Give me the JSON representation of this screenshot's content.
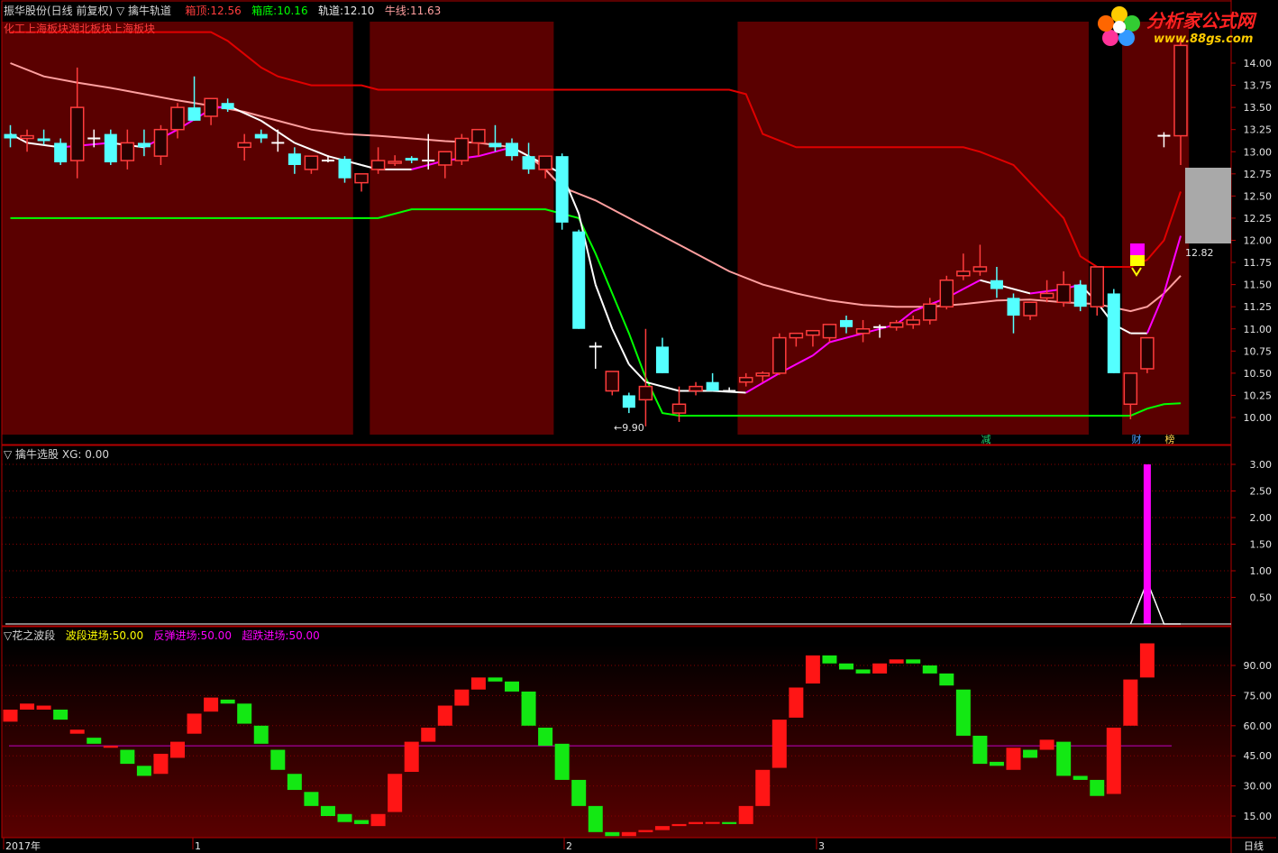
{
  "header": {
    "title": "振华股份(日线 前复权) ▽ 擒牛轨道",
    "box_top_label": "箱顶:",
    "box_top_value": "12.56",
    "box_bottom_label": "箱底:",
    "box_bottom_value": "10.16",
    "track_label": "轨道:",
    "track_value": "12.10",
    "bull_label": "牛线:",
    "bull_value": "11.63",
    "sectors": "化工上海板块湖北板块上海板块"
  },
  "logo": {
    "name": "分析家公式网",
    "url": "www.88gs.com"
  },
  "markers": {
    "min_label": "←9.90",
    "price_box": "12.82",
    "m1": "减",
    "m2": "财",
    "m3": "榜"
  },
  "panel2": {
    "title": "▽ 擒牛选股",
    "xg_label": "XG:",
    "xg_value": "0.00"
  },
  "panel3": {
    "title": "▽花之波段",
    "l1": "波段进场:",
    "v1": "50.00",
    "l2": "反弹进场:",
    "v2": "50.00",
    "l3": "超跌进场:",
    "v3": "50.00"
  },
  "footer": {
    "year": "2017年",
    "m1": "1",
    "m2": "2",
    "m3": "3",
    "period": "日线"
  },
  "colors": {
    "up": "#ff3c3c",
    "down": "#54ffff",
    "panel_bg": "#5a0000",
    "border": "#b40000",
    "green": "#00ff00",
    "magenta": "#ff00ff",
    "pink": "#ff9f9f"
  },
  "chart_data": [
    {
      "type": "candlestick",
      "title": "振华股份(日线 前复权)",
      "ylim": [
        9.8,
        14.2
      ],
      "yticks": [
        10.0,
        10.25,
        10.5,
        10.75,
        11.0,
        11.25,
        11.5,
        11.75,
        12.0,
        12.25,
        12.5,
        12.75,
        13.0,
        13.25,
        13.5,
        13.75,
        14.0
      ],
      "ohlc": [
        [
          13.2,
          13.3,
          13.05,
          13.15
        ],
        [
          13.15,
          13.25,
          13.0,
          13.18
        ],
        [
          13.15,
          13.25,
          13.08,
          13.12
        ],
        [
          13.1,
          13.15,
          12.85,
          12.88
        ],
        [
          12.9,
          13.95,
          12.7,
          13.5
        ],
        [
          13.15,
          13.25,
          13.05,
          13.15
        ],
        [
          13.2,
          13.25,
          12.85,
          12.88
        ],
        [
          12.9,
          13.25,
          12.8,
          13.1
        ],
        [
          13.1,
          13.25,
          12.95,
          13.05
        ],
        [
          12.95,
          13.3,
          12.85,
          13.25
        ],
        [
          13.25,
          13.55,
          13.15,
          13.5
        ],
        [
          13.5,
          13.85,
          13.35,
          13.35
        ],
        [
          13.4,
          13.6,
          13.3,
          13.6
        ],
        [
          13.55,
          13.6,
          13.45,
          13.48
        ],
        [
          13.05,
          13.2,
          12.9,
          13.1
        ],
        [
          13.2,
          13.25,
          13.1,
          13.15
        ],
        [
          13.1,
          13.25,
          13.0,
          13.1
        ],
        [
          12.98,
          13.05,
          12.75,
          12.85
        ],
        [
          12.8,
          12.95,
          12.75,
          12.95
        ],
        [
          12.92,
          12.96,
          12.88,
          12.9
        ],
        [
          12.92,
          12.95,
          12.65,
          12.7
        ],
        [
          12.65,
          12.75,
          12.55,
          12.75
        ],
        [
          12.8,
          13.05,
          12.75,
          12.9
        ],
        [
          12.87,
          12.96,
          12.84,
          12.89
        ],
        [
          12.93,
          12.95,
          12.87,
          12.9
        ],
        [
          12.9,
          13.2,
          12.8,
          12.9
        ],
        [
          12.85,
          12.95,
          12.7,
          13.0
        ],
        [
          12.9,
          13.2,
          12.85,
          13.15
        ],
        [
          13.1,
          13.2,
          12.95,
          13.25
        ],
        [
          13.1,
          13.3,
          13.0,
          13.05
        ],
        [
          13.1,
          13.15,
          12.9,
          12.95
        ],
        [
          12.95,
          13.1,
          12.75,
          12.8
        ],
        [
          12.8,
          12.85,
          12.7,
          12.95
        ],
        [
          12.95,
          12.98,
          12.12,
          12.2
        ],
        [
          12.1,
          12.12,
          11.0,
          11.0
        ],
        [
          10.8,
          10.85,
          10.55,
          10.8
        ],
        [
          10.3,
          10.52,
          10.25,
          10.52
        ],
        [
          10.25,
          10.28,
          10.05,
          10.11
        ],
        [
          10.2,
          11.0,
          9.9,
          10.35
        ],
        [
          10.8,
          10.9,
          10.5,
          10.5
        ],
        [
          10.05,
          10.35,
          9.95,
          10.15
        ],
        [
          10.3,
          10.4,
          10.25,
          10.35
        ],
        [
          10.4,
          10.5,
          10.3,
          10.3
        ],
        [
          10.32,
          10.34,
          10.28,
          10.3
        ],
        [
          10.4,
          10.5,
          10.35,
          10.45
        ],
        [
          10.47,
          10.52,
          10.4,
          10.5
        ],
        [
          10.5,
          10.95,
          10.48,
          10.9
        ],
        [
          10.9,
          10.95,
          10.8,
          10.95
        ],
        [
          10.93,
          10.98,
          10.8,
          10.98
        ],
        [
          10.9,
          11.05,
          10.85,
          11.05
        ],
        [
          11.1,
          11.15,
          10.95,
          11.02
        ],
        [
          10.95,
          11.1,
          10.85,
          11.0
        ],
        [
          11.0,
          11.05,
          10.9,
          11.02
        ],
        [
          11.02,
          11.1,
          10.98,
          11.07
        ],
        [
          11.05,
          11.15,
          11.0,
          11.1
        ],
        [
          11.1,
          11.35,
          11.05,
          11.28
        ],
        [
          11.25,
          11.6,
          11.22,
          11.55
        ],
        [
          11.6,
          11.85,
          11.55,
          11.65
        ],
        [
          11.65,
          11.95,
          11.6,
          11.7
        ],
        [
          11.55,
          11.7,
          11.35,
          11.45
        ],
        [
          11.35,
          11.4,
          10.95,
          11.15
        ],
        [
          11.15,
          11.3,
          11.1,
          11.3
        ],
        [
          11.35,
          11.55,
          11.3,
          11.4
        ],
        [
          11.3,
          11.65,
          11.25,
          11.5
        ],
        [
          11.5,
          11.55,
          11.2,
          11.25
        ],
        [
          11.25,
          11.7,
          11.15,
          11.7
        ],
        [
          11.4,
          11.45,
          10.5,
          10.5
        ],
        [
          10.15,
          10.5,
          9.98,
          10.5
        ],
        [
          10.55,
          10.9,
          10.5,
          10.9
        ],
        [
          13.17,
          13.22,
          13.05,
          13.18
        ],
        [
          13.18,
          14.3,
          12.85,
          14.2
        ]
      ],
      "track": [
        [
          "0",
          14.35
        ],
        [
          "12",
          14.35
        ],
        [
          "13",
          14.25
        ],
        [
          "15",
          13.95
        ],
        [
          "16",
          13.85
        ],
        [
          "18",
          13.75
        ],
        [
          "21",
          13.75
        ],
        [
          "22",
          13.7
        ],
        [
          "43",
          13.7
        ],
        [
          "44",
          13.65
        ],
        [
          "45",
          13.2
        ],
        [
          "47",
          13.05
        ],
        [
          "57",
          13.05
        ],
        [
          "58",
          13.0
        ],
        [
          "60",
          12.85
        ],
        [
          "61",
          12.65
        ],
        [
          "63",
          12.25
        ],
        [
          "64",
          11.82
        ],
        [
          "65",
          11.7
        ],
        [
          "67",
          11.7
        ],
        [
          "68",
          11.78
        ],
        [
          "69",
          12.0
        ],
        [
          "70",
          12.55
        ]
      ],
      "short_ma": [
        [
          "0",
          13.2
        ],
        [
          "1",
          13.1
        ],
        [
          "3",
          13.05
        ],
        [
          "6",
          13.1
        ],
        [
          "8",
          13.05
        ],
        [
          "10",
          13.25
        ],
        [
          "12",
          13.48
        ],
        [
          "13",
          13.52
        ],
        [
          "15",
          13.35
        ],
        [
          "17",
          13.1
        ],
        [
          "19",
          12.95
        ],
        [
          "21",
          12.85
        ],
        [
          "22",
          12.8
        ],
        [
          "24",
          12.8
        ],
        [
          "26",
          12.9
        ],
        [
          "28",
          12.95
        ],
        [
          "30",
          13.05
        ],
        [
          "31",
          12.95
        ],
        [
          "33",
          12.75
        ],
        [
          "34",
          12.3
        ],
        [
          "35",
          11.5
        ],
        [
          "36",
          11.0
        ],
        [
          "37",
          10.6
        ],
        [
          "38",
          10.4
        ],
        [
          "40",
          10.3
        ],
        [
          "42",
          10.3
        ],
        [
          "44",
          10.28
        ],
        [
          "46",
          10.5
        ],
        [
          "48",
          10.7
        ],
        [
          "49",
          10.85
        ],
        [
          "51",
          10.95
        ],
        [
          "53",
          11.05
        ],
        [
          "54",
          11.2
        ],
        [
          "56",
          11.35
        ],
        [
          "57",
          11.45
        ],
        [
          "58",
          11.55
        ],
        [
          "59",
          11.5
        ],
        [
          "61",
          11.4
        ],
        [
          "63",
          11.45
        ],
        [
          "64",
          11.5
        ],
        [
          "65",
          11.3
        ],
        [
          "66",
          11.05
        ],
        [
          "67",
          10.95
        ],
        [
          "68",
          10.95
        ],
        [
          "69",
          11.4
        ],
        [
          "70",
          12.05
        ]
      ],
      "slow_ma": [
        [
          "0",
          14.0
        ],
        [
          "2",
          13.85
        ],
        [
          "4",
          13.78
        ],
        [
          "6",
          13.72
        ],
        [
          "8",
          13.65
        ],
        [
          "10",
          13.58
        ],
        [
          "12",
          13.52
        ],
        [
          "14",
          13.45
        ],
        [
          "16",
          13.35
        ],
        [
          "18",
          13.25
        ],
        [
          "20",
          13.2
        ],
        [
          "22",
          13.18
        ],
        [
          "24",
          13.15
        ],
        [
          "26",
          13.12
        ],
        [
          "28",
          13.1
        ],
        [
          "30",
          13.05
        ],
        [
          "31",
          12.95
        ],
        [
          "32",
          12.8
        ],
        [
          "33",
          12.6
        ],
        [
          "35",
          12.45
        ],
        [
          "37",
          12.25
        ],
        [
          "39",
          12.05
        ],
        [
          "41",
          11.85
        ],
        [
          "43",
          11.65
        ],
        [
          "45",
          11.5
        ],
        [
          "47",
          11.4
        ],
        [
          "49",
          11.32
        ],
        [
          "51",
          11.27
        ],
        [
          "53",
          11.25
        ],
        [
          "55",
          11.25
        ],
        [
          "57",
          11.28
        ],
        [
          "59",
          11.32
        ],
        [
          "61",
          11.33
        ],
        [
          "63",
          11.3
        ],
        [
          "65",
          11.28
        ],
        [
          "67",
          11.2
        ],
        [
          "68",
          11.25
        ],
        [
          "69",
          11.4
        ],
        [
          "70",
          11.6
        ]
      ],
      "bull_line": [
        [
          "0",
          12.25
        ],
        [
          "22",
          12.25
        ],
        [
          "24",
          12.35
        ],
        [
          "32",
          12.35
        ],
        [
          "33",
          12.3
        ],
        [
          "34",
          12.25
        ],
        [
          "35",
          11.85
        ],
        [
          "36",
          11.4
        ],
        [
          "37",
          10.95
        ],
        [
          "38",
          10.45
        ],
        [
          "39",
          10.05
        ],
        [
          "40",
          10.02
        ],
        [
          "66",
          10.02
        ],
        [
          "67",
          10.02
        ],
        [
          "68",
          10.1
        ],
        [
          "69",
          10.15
        ],
        [
          "70",
          10.16
        ]
      ]
    },
    {
      "type": "bar",
      "title": "擒牛选股",
      "ylim": [
        0,
        3.2
      ],
      "yticks": [
        0.5,
        1.0,
        1.5,
        2.0,
        2.5,
        3.0
      ],
      "signal_index": 68,
      "value": 3.0,
      "line_points": [
        [
          "67",
          0.0
        ],
        [
          "68",
          0.8
        ],
        [
          "69",
          0.0
        ],
        [
          "70",
          0.0
        ]
      ]
    },
    {
      "type": "bar",
      "title": "花之波段",
      "ylim": [
        5,
        105
      ],
      "yticks": [
        15.0,
        30.0,
        45.0,
        60.0,
        75.0,
        90.0
      ],
      "threshold": 50,
      "segments": [
        [
          62,
          68
        ],
        [
          68,
          71
        ],
        [
          68,
          70
        ],
        [
          68,
          63
        ],
        [
          56,
          58
        ],
        [
          54,
          51
        ],
        [
          49,
          50
        ],
        [
          48,
          41
        ],
        [
          40,
          35
        ],
        [
          36,
          46
        ],
        [
          44,
          52
        ],
        [
          56,
          66
        ],
        [
          67,
          74
        ],
        [
          73,
          71
        ],
        [
          71,
          61
        ],
        [
          60,
          51
        ],
        [
          48,
          38
        ],
        [
          36,
          28
        ],
        [
          27,
          20
        ],
        [
          20,
          15
        ],
        [
          16,
          12
        ],
        [
          13,
          11
        ],
        [
          10,
          16
        ],
        [
          17,
          36
        ],
        [
          37,
          52
        ],
        [
          52,
          59
        ],
        [
          60,
          70
        ],
        [
          70,
          78
        ],
        [
          78,
          84
        ],
        [
          84,
          82
        ],
        [
          82,
          77
        ],
        [
          77,
          60
        ],
        [
          59,
          50
        ],
        [
          51,
          33
        ],
        [
          33,
          20
        ],
        [
          20,
          7
        ],
        [
          7,
          5
        ],
        [
          5,
          7
        ],
        [
          7,
          8
        ],
        [
          8,
          10
        ],
        [
          10,
          11
        ],
        [
          11,
          12
        ],
        [
          12,
          12
        ],
        [
          12,
          11
        ],
        [
          11,
          20
        ],
        [
          20,
          38
        ],
        [
          39,
          63
        ],
        [
          64,
          79
        ],
        [
          81,
          95
        ],
        [
          95,
          91
        ],
        [
          91,
          88
        ],
        [
          88,
          86
        ],
        [
          86,
          91
        ],
        [
          91,
          93
        ],
        [
          93,
          91
        ],
        [
          90,
          86
        ],
        [
          86,
          80
        ],
        [
          78,
          55
        ],
        [
          55,
          41
        ],
        [
          42,
          40
        ],
        [
          38,
          49
        ],
        [
          48,
          44
        ],
        [
          48,
          53
        ],
        [
          52,
          35
        ],
        [
          35,
          33
        ],
        [
          33,
          25
        ],
        [
          26,
          59
        ],
        [
          60,
          83
        ],
        [
          84,
          101
        ]
      ]
    }
  ]
}
